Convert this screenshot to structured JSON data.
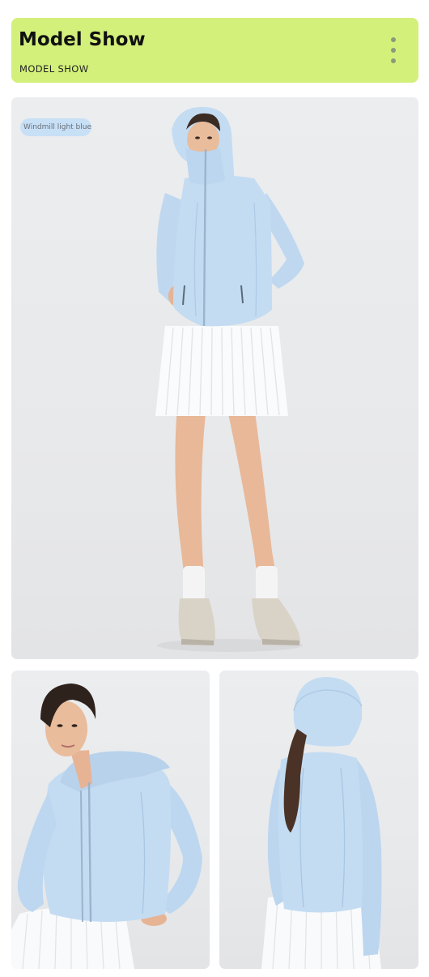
{
  "header": {
    "title": "Model Show",
    "subtitle": "MODEL SHOW",
    "accent_color": "#d3f07a",
    "menu_icon": "more-vertical-icon"
  },
  "main_photo": {
    "color_tag": "Windmill light blue",
    "jacket_color": "#c4dcf2"
  },
  "detail_photos": [
    {
      "view": "front-closeup"
    },
    {
      "view": "back-hooded"
    }
  ]
}
